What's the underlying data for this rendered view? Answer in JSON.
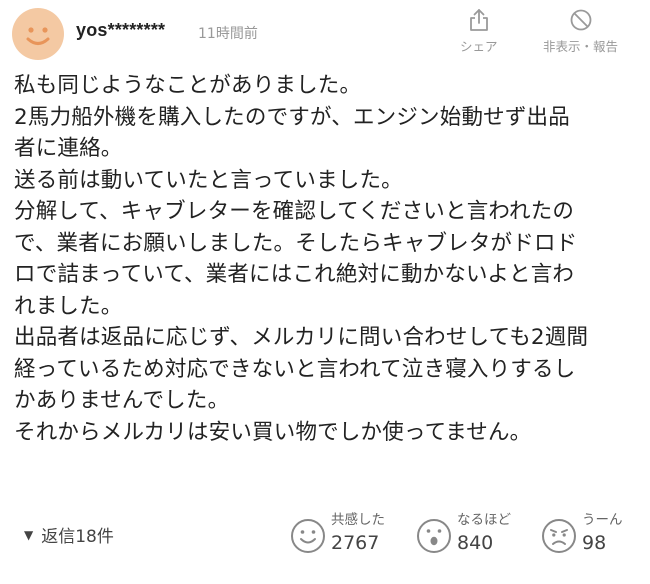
{
  "comment": {
    "username": "yos********",
    "timestamp": "11時間前",
    "actions": {
      "share_label": "シェア",
      "hide_report_label": "非表示・報告"
    },
    "body_lines": [
      "私も同じようなことがありました。",
      "2馬力船外機を購入したのですが、エンジン始動せず出品",
      "者に連絡。",
      "送る前は動いていたと言っていました。",
      "分解して、キャブレターを確認してくださいと言われたの",
      "で、業者にお願いしました。そしたらキャブレタがドロド",
      "ロで詰まっていて、業者にはこれ絶対に動かないよと言わ",
      "れました。",
      "出品者は返品に応じず、メルカリに問い合わせしても2週間",
      "経っているため対応できないと言われて泣き寝入りするし",
      "かありませんでした。",
      "それからメルカリは安い買い物でしか使ってません。"
    ],
    "replies_label": "返信18件",
    "reactions": [
      {
        "icon": "smile-face-icon",
        "label": "共感した",
        "count": "2767"
      },
      {
        "icon": "surprised-face-icon",
        "label": "なるほど",
        "count": "840"
      },
      {
        "icon": "frown-face-icon",
        "label": "うーん",
        "count": "98"
      }
    ]
  },
  "colors": {
    "avatar_bg": "#f4c9a3",
    "avatar_face": "#e8955a",
    "muted_text": "#999999",
    "body_text": "#222222"
  }
}
